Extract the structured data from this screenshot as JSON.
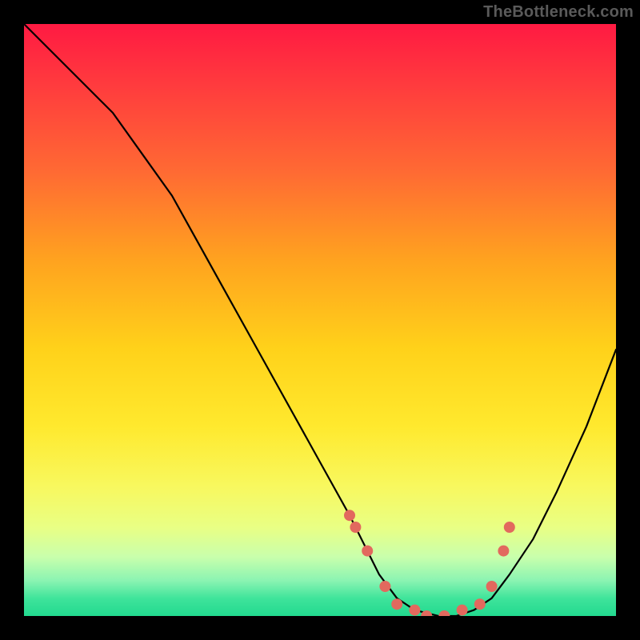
{
  "watermark": "TheBottleneck.com",
  "chart_data": {
    "type": "line",
    "title": "",
    "xlabel": "",
    "ylabel": "",
    "xlim": [
      0,
      100
    ],
    "ylim": [
      0,
      100
    ],
    "series": [
      {
        "name": "bottleneck-curve",
        "x": [
          0,
          5,
          10,
          15,
          20,
          25,
          30,
          35,
          40,
          45,
          50,
          55,
          58,
          60,
          63,
          66,
          70,
          73,
          76,
          79,
          82,
          86,
          90,
          95,
          100
        ],
        "y": [
          100,
          95,
          90,
          85,
          78,
          71,
          62,
          53,
          44,
          35,
          26,
          17,
          11,
          7,
          3,
          1,
          0,
          0,
          1,
          3,
          7,
          13,
          21,
          32,
          45
        ]
      }
    ],
    "markers": {
      "name": "highlighted-points",
      "color": "#e2695e",
      "x": [
        55,
        56,
        58,
        61,
        63,
        66,
        68,
        71,
        74,
        77,
        79,
        81,
        82
      ],
      "y": [
        17,
        15,
        11,
        5,
        2,
        1,
        0,
        0,
        1,
        2,
        5,
        11,
        15
      ]
    },
    "gradient_stops": [
      {
        "pos": 0,
        "color": "#ff1a42"
      },
      {
        "pos": 25,
        "color": "#ff6a33"
      },
      {
        "pos": 55,
        "color": "#ffd21a"
      },
      {
        "pos": 85,
        "color": "#e9ff84"
      },
      {
        "pos": 100,
        "color": "#22d98f"
      }
    ]
  }
}
